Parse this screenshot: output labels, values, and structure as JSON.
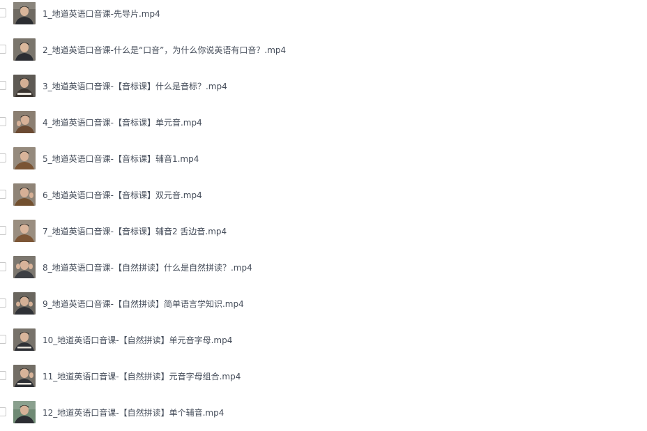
{
  "files": [
    {
      "name": "1_地道英语口音课-先导片.mp4",
      "thumb": "presenter-video-thumbnail"
    },
    {
      "name": "2_地道英语口音课-什么是“口音”，为什么你说英语有口音？.mp4",
      "thumb": "presenter-video-thumbnail"
    },
    {
      "name": "3_地道英语口音课-【音标课】什么是音标？.mp4",
      "thumb": "presenter-video-thumbnail"
    },
    {
      "name": "4_地道英语口音课-【音标课】单元音.mp4",
      "thumb": "presenter-video-thumbnail"
    },
    {
      "name": "5_地道英语口音课-【音标课】辅音1.mp4",
      "thumb": "presenter-video-thumbnail"
    },
    {
      "name": "6_地道英语口音课-【音标课】双元音.mp4",
      "thumb": "presenter-video-thumbnail"
    },
    {
      "name": "7_地道英语口音课-【音标课】辅音2 舌边音.mp4",
      "thumb": "presenter-video-thumbnail"
    },
    {
      "name": "8_地道英语口音课-【自然拼读】什么是自然拼读？.mp4",
      "thumb": "presenter-video-thumbnail"
    },
    {
      "name": "9_地道英语口音课-【自然拼读】简单语言学知识.mp4",
      "thumb": "presenter-video-thumbnail"
    },
    {
      "name": "10_地道英语口音课-【自然拼读】单元音字母.mp4",
      "thumb": "presenter-video-thumbnail"
    },
    {
      "name": "11_地道英语口音课-【自然拼读】元音字母组合.mp4",
      "thumb": "presenter-video-thumbnail"
    },
    {
      "name": "12_地道英语口音课-【自然拼读】单个辅音.mp4",
      "thumb": "presenter-video-thumbnail"
    }
  ],
  "colors": {
    "file_name_text": "#454d5a",
    "checkbox_border": "#c8c8c8",
    "background": "#ffffff"
  }
}
